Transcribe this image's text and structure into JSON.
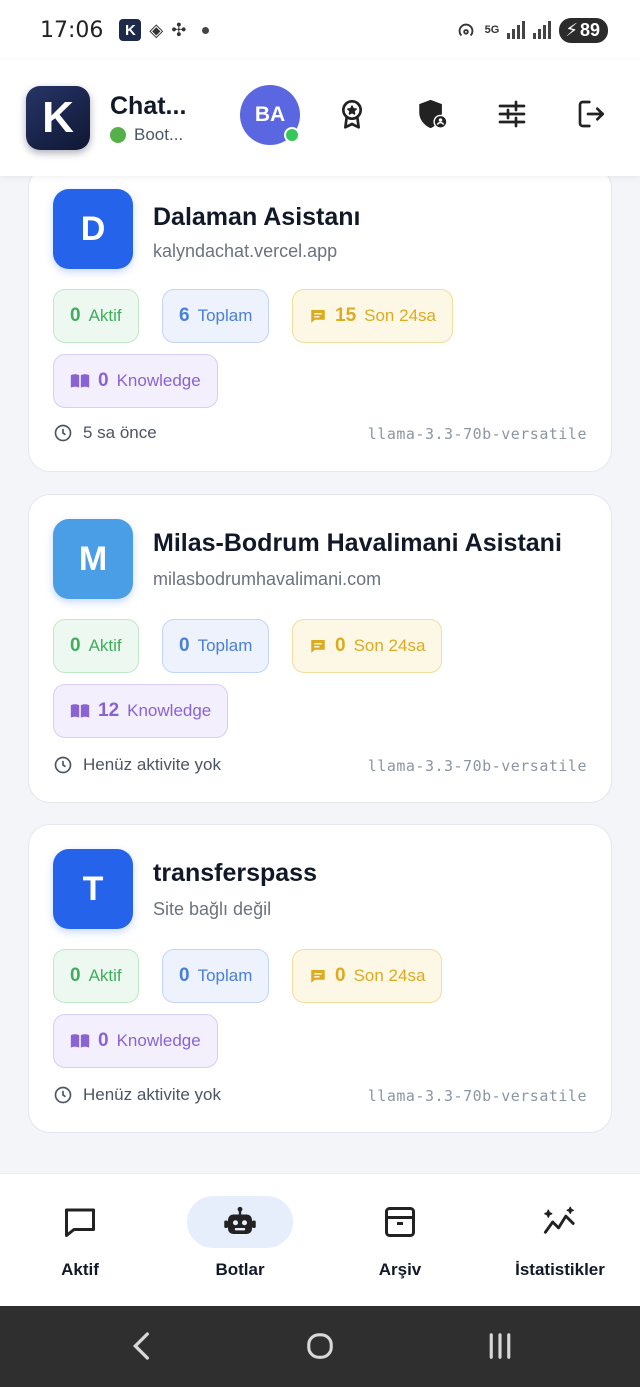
{
  "status_bar": {
    "time": "17:06",
    "network": "5G",
    "battery": "89"
  },
  "header": {
    "title": "Chat...",
    "subtitle": "Boot...",
    "avatar_initials": "BA",
    "icons": [
      "award-icon",
      "shield-user-icon",
      "sliders-icon",
      "logout-icon"
    ]
  },
  "bots": [
    {
      "initial": "D",
      "color": "#2563eb",
      "name": "Dalaman Asistanı",
      "site": "kalyndachat.vercel.app",
      "active_count": "0",
      "active_label": "Aktif",
      "total_count": "6",
      "total_label": "Toplam",
      "recent_count": "15",
      "recent_label": "Son 24sa",
      "knowledge_count": "0",
      "knowledge_label": "Knowledge",
      "last_activity": "5 sa önce",
      "model": "llama-3.3-70b-versatile"
    },
    {
      "initial": "M",
      "color": "#4a9ee6",
      "name": "Milas-Bodrum Havalimani Asistani",
      "site": "milasbodrumhavalimani.com",
      "active_count": "0",
      "active_label": "Aktif",
      "total_count": "0",
      "total_label": "Toplam",
      "recent_count": "0",
      "recent_label": "Son 24sa",
      "knowledge_count": "12",
      "knowledge_label": "Knowledge",
      "last_activity": "Henüz aktivite yok",
      "model": "llama-3.3-70b-versatile"
    },
    {
      "initial": "T",
      "color": "#2563eb",
      "name": "transferspass",
      "site": "Site bağlı değil",
      "active_count": "0",
      "active_label": "Aktif",
      "total_count": "0",
      "total_label": "Toplam",
      "recent_count": "0",
      "recent_label": "Son 24sa",
      "knowledge_count": "0",
      "knowledge_label": "Knowledge",
      "last_activity": "Henüz aktivite yok",
      "model": "llama-3.3-70b-versatile"
    }
  ],
  "bottom_nav": [
    {
      "label": "Aktif",
      "icon": "message-square-icon",
      "active": false
    },
    {
      "label": "Botlar",
      "icon": "bot-icon",
      "active": true
    },
    {
      "label": "Arşiv",
      "icon": "archive-icon",
      "active": false
    },
    {
      "label": "İstatistikler",
      "icon": "stats-sparkle-icon",
      "active": false
    }
  ],
  "colors": {
    "active_tab": "#e7eefb",
    "online": "#34c759",
    "avatar": "#5a67e0"
  }
}
